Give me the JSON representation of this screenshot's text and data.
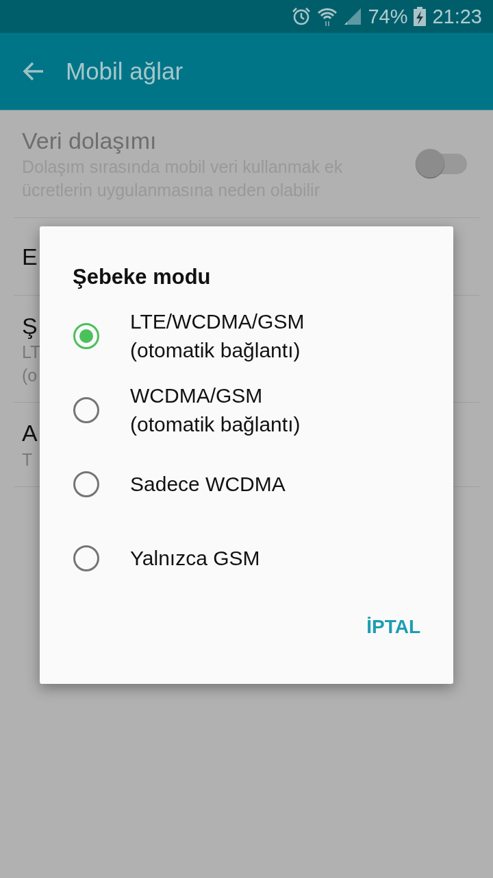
{
  "status_bar": {
    "battery": "74%",
    "time": "21:23"
  },
  "app_bar": {
    "title": "Mobil ağlar"
  },
  "settings": [
    {
      "kind": "switch",
      "title": "Veri dolaşımı",
      "subtitle": "Dolaşım sırasında mobil veri kullanmak ek ücretlerin uygulanmasına neden olabilir",
      "disabled": true,
      "on": false
    },
    {
      "kind": "text",
      "title": "E"
    },
    {
      "kind": "text",
      "title": "Ş",
      "subtitle_lines": [
        "LT",
        "(o"
      ]
    },
    {
      "kind": "text",
      "title": "A",
      "subtitle_lines": [
        "T"
      ]
    }
  ],
  "dialog": {
    "title": "Şebeke modu",
    "options": [
      {
        "label": [
          "LTE/WCDMA/GSM",
          "(otomatik bağlantı)"
        ],
        "selected": true
      },
      {
        "label": [
          "WCDMA/GSM",
          "(otomatik bağlantı)"
        ],
        "selected": false
      },
      {
        "label": [
          "Sadece WCDMA"
        ],
        "selected": false
      },
      {
        "label": [
          "Yalnızca GSM"
        ],
        "selected": false
      }
    ],
    "buttons": [
      "İPTAL"
    ]
  }
}
